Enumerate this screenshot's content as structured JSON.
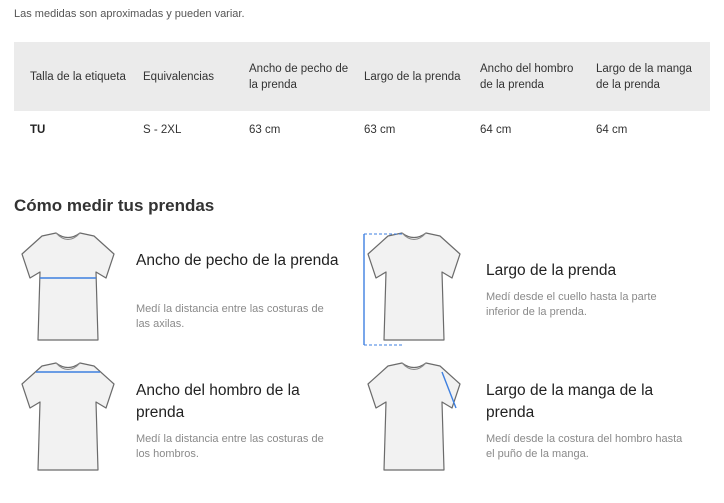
{
  "disclaimer": "Las medidas son aproximadas y pueden variar.",
  "size_table": {
    "headers": [
      "Talla de la etiqueta",
      "Equivalencias",
      "Ancho de pecho de la prenda",
      "Largo de la prenda",
      "Ancho del hombro de la prenda",
      "Largo de la manga de la prenda"
    ],
    "rows": [
      [
        "TU",
        "S - 2XL",
        "63 cm",
        "63 cm",
        "64 cm",
        "64 cm"
      ]
    ]
  },
  "how_to_measure": {
    "title": "Cómo medir tus prendas",
    "cards": [
      {
        "title": "Ancho de pecho de la prenda",
        "description": "Medí la distancia entre las costuras de las axilas.",
        "icon": "tshirt-chest-width-icon"
      },
      {
        "title": "Largo de la prenda",
        "description": "Medí desde el cuello hasta la parte inferior de la prenda.",
        "icon": "tshirt-length-icon"
      },
      {
        "title": "Ancho del hombro de la prenda",
        "description": "Medí la distancia entre las costuras de los hombros.",
        "icon": "tshirt-shoulder-width-icon"
      },
      {
        "title": "Largo de la manga de la prenda",
        "description": "Medí desde la costura del hombro hasta el puño de la manga.",
        "icon": "tshirt-sleeve-length-icon"
      }
    ]
  },
  "colors": {
    "measure_line": "#3d7fe0",
    "table_header_bg": "#ebebeb"
  }
}
